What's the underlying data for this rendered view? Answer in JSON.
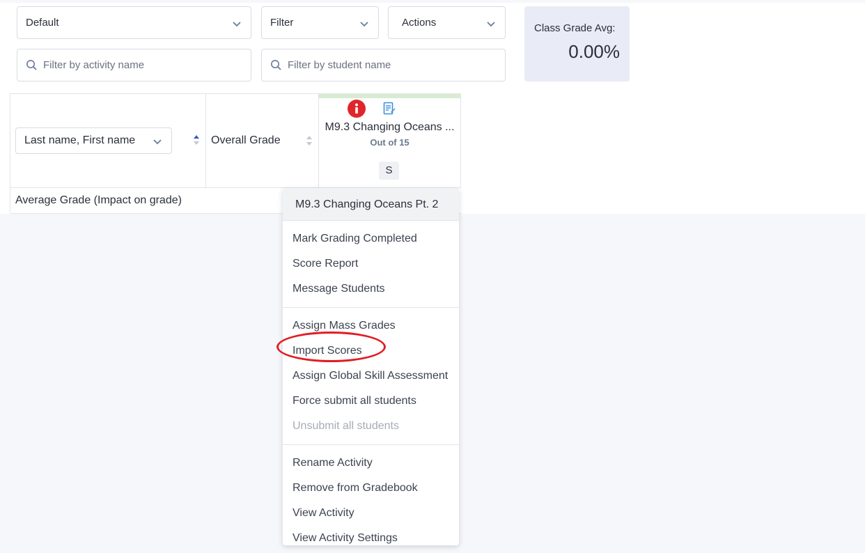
{
  "toolbar": {
    "view_select": "Default",
    "filter_select": "Filter",
    "actions_select": "Actions",
    "activity_search_placeholder": "Filter by activity name",
    "student_search_placeholder": "Filter by student name"
  },
  "class_average": {
    "label": "Class Grade Avg:",
    "value": "0.00%"
  },
  "grid": {
    "name_sort_select": "Last name, First name",
    "overall_grade_label": "Overall Grade",
    "activity": {
      "title": "M9.3 Changing Oceans ...",
      "subtitle": "Out of 15",
      "badge": "S"
    },
    "average_row_label": "Average Grade (Impact on grade)"
  },
  "context_menu": {
    "header": "M9.3 Changing Oceans Pt. 2",
    "groups": [
      {
        "items": [
          {
            "label": "Mark Grading Completed",
            "disabled": false
          },
          {
            "label": "Score Report",
            "disabled": false
          },
          {
            "label": "Message Students",
            "disabled": false
          }
        ]
      },
      {
        "items": [
          {
            "label": "Assign Mass Grades",
            "disabled": false
          },
          {
            "label": "Import Scores",
            "disabled": false
          },
          {
            "label": "Assign Global Skill Assessment",
            "disabled": false
          },
          {
            "label": "Force submit all students",
            "disabled": false
          },
          {
            "label": "Unsubmit all students",
            "disabled": true
          }
        ]
      },
      {
        "items": [
          {
            "label": "Rename Activity",
            "disabled": false
          },
          {
            "label": "Remove from Gradebook",
            "disabled": false
          },
          {
            "label": "View Activity",
            "disabled": false
          },
          {
            "label": "View Activity Settings",
            "disabled": false
          }
        ]
      }
    ]
  },
  "icons": {
    "chevron": "chevron-down-icon",
    "search": "search-icon",
    "info": "info-icon",
    "activity_doc": "document-edit-icon",
    "sort": "sort-icon"
  },
  "colors": {
    "info_red": "#e0262b",
    "doc_blue": "#3d8fe0",
    "highlight_red": "#e01e24",
    "sort_active": "#3a56c8",
    "card_bg": "#e9ebf6"
  }
}
